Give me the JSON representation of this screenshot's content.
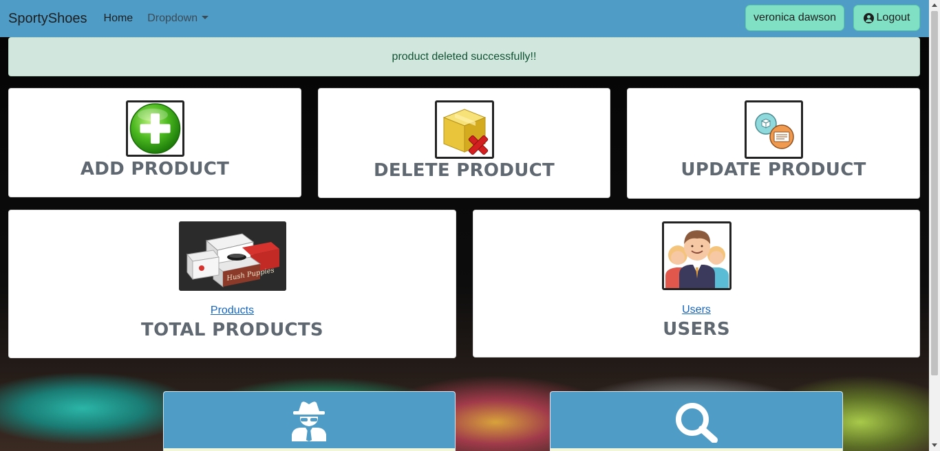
{
  "navbar": {
    "brand": "SportyShoes",
    "home_label": "Home",
    "dropdown_label": "Dropdown",
    "user_label": "veronica dawson",
    "logout_label": "Logout"
  },
  "alert": {
    "message": "product deleted successfully!!"
  },
  "cards": {
    "add": {
      "title": "ADD PRODUCT",
      "icon": "add-plus-icon"
    },
    "delete": {
      "title": "DELETE PRODUCT",
      "icon": "box-delete-icon"
    },
    "update": {
      "title": "UPDATE PRODUCT",
      "icon": "box-update-icon"
    },
    "products": {
      "title": "TOTAL PRODUCTS",
      "link": "Products",
      "image_text": "Hush Puppies",
      "icon": "shoe-boxes-image"
    },
    "users": {
      "title": "USERS",
      "link": "Users",
      "icon": "users-group-icon"
    }
  },
  "bottom_cards": [
    {
      "icon": "spy-icon"
    },
    {
      "icon": "search-icon"
    }
  ],
  "colors": {
    "navbar": "#4f9cc6",
    "button": "#7fe0c3",
    "alert_bg": "#d1e7dd",
    "alert_text": "#0f5132",
    "card_title": "#5f6770",
    "link": "#1565c0"
  }
}
